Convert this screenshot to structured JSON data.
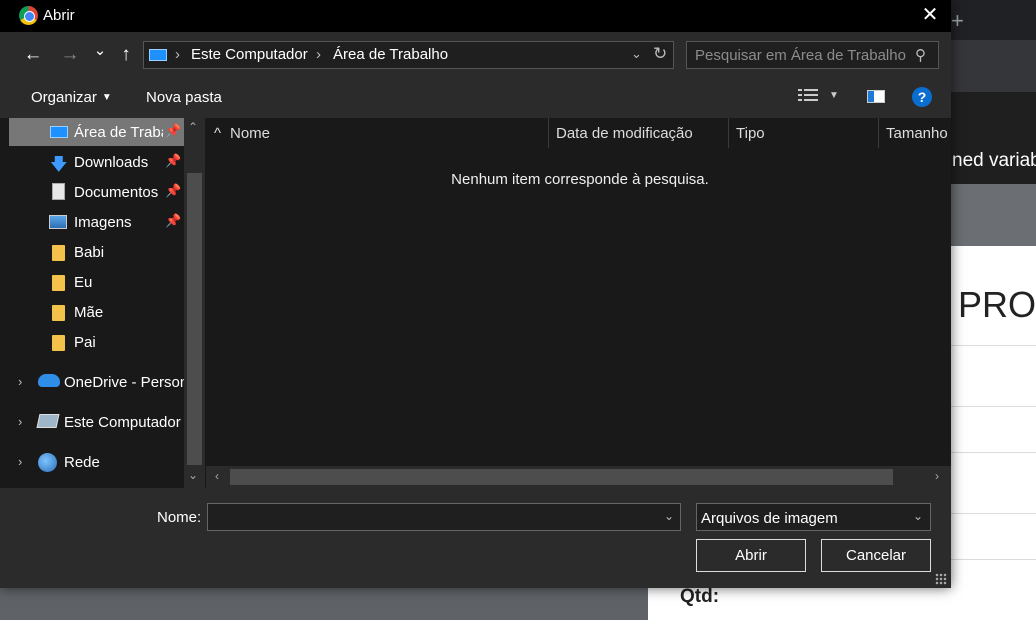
{
  "background_page": {
    "new_tab_symbol": "+",
    "header_text": "ned variab",
    "card_title": "PRO",
    "qtd_label": "Qtd:"
  },
  "dialog": {
    "title": "Abrir",
    "close_symbol": "✕",
    "nav": {
      "back_symbol": "←",
      "forward_symbol": "→",
      "recent_symbol": "⌄",
      "up_symbol": "↑"
    },
    "address": {
      "crumbs": [
        "Este Computador",
        "Área de Trabalho"
      ],
      "separator": "›",
      "dropdown_symbol": "⌄",
      "refresh_symbol": "↻"
    },
    "search": {
      "placeholder": "Pesquisar em Área de Trabalho",
      "icon_symbol": "⚲"
    },
    "toolbar": {
      "organize_label": "Organizar",
      "organize_caret": "▼",
      "new_folder_label": "Nova pasta",
      "view_caret": "▼",
      "help_symbol": "?"
    },
    "nav_pane": {
      "items": [
        {
          "label": "Área de Trabalho",
          "icon": "desktop-icon",
          "pinned": true,
          "selected": true
        },
        {
          "label": "Downloads",
          "icon": "download-icon",
          "pinned": true
        },
        {
          "label": "Documentos",
          "icon": "document-icon",
          "pinned": true
        },
        {
          "label": "Imagens",
          "icon": "image-icon",
          "pinned": true
        },
        {
          "label": "Babi",
          "icon": "folder-icon"
        },
        {
          "label": "Eu",
          "icon": "folder-icon"
        },
        {
          "label": "Mãe",
          "icon": "folder-icon"
        },
        {
          "label": "Pai",
          "icon": "folder-icon"
        },
        {
          "label": "OneDrive - Personal",
          "icon": "onedrive-icon",
          "expandable": true
        },
        {
          "label": "Este Computador",
          "icon": "computer-icon",
          "expandable": true
        },
        {
          "label": "Rede",
          "icon": "network-icon",
          "expandable": true
        }
      ],
      "pin_symbol": "📌",
      "chevron_symbol": "›"
    },
    "columns": [
      "Nome",
      "Data de modificação",
      "Tipo",
      "Tamanho"
    ],
    "sort_symbol": "^",
    "empty_message": "Nenhum item corresponde à pesquisa.",
    "scroll": {
      "up": "⌃",
      "down": "⌄",
      "left": "‹",
      "right": "›"
    },
    "footer": {
      "name_label": "Nome:",
      "name_value": "",
      "name_dropdown_symbol": "⌄",
      "file_type": "Arquivos de imagem",
      "file_type_dropdown_symbol": "⌄",
      "open_label": "Abrir",
      "cancel_label": "Cancelar"
    }
  }
}
